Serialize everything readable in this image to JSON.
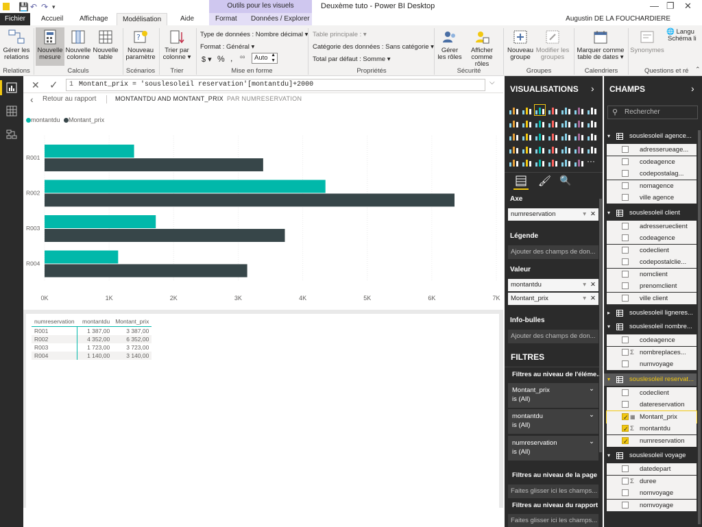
{
  "window": {
    "title": "Deuxème tuto - Power BI Desktop",
    "context_group": "Outils pour les visuels",
    "user": "Augustin DE LA FOUCHARDIERE"
  },
  "tabs": [
    "Fichier",
    "Accueil",
    "Affichage",
    "Modélisation",
    "Aide",
    "Format",
    "Données / Explorer"
  ],
  "ribbon": {
    "buttons": [
      {
        "label1": "Gérer les",
        "label2": "relations"
      },
      {
        "label1": "Nouvelle",
        "label2": "mesure"
      },
      {
        "label1": "Nouvelle",
        "label2": "colonne"
      },
      {
        "label1": "Nouvelle",
        "label2": "table"
      },
      {
        "label1": "Nouveau",
        "label2": "paramètre"
      },
      {
        "label1": "Trier par",
        "label2": "colonne ▾"
      },
      {
        "label1": "Gérer",
        "label2": "les rôles"
      },
      {
        "label1": "Afficher",
        "label2": "comme rôles"
      },
      {
        "label1": "Nouveau",
        "label2": "groupe"
      },
      {
        "label1": "Modifier les",
        "label2": "groupes"
      },
      {
        "label1": "Marquer comme",
        "label2": "table de dates ▾"
      },
      {
        "label1": "Synonymes",
        "label2": ""
      },
      {
        "label1": "Langu",
        "label2": "Schéma li"
      }
    ],
    "format": {
      "type": "Type de données : Nombre décimal ▾",
      "format": "Format : Général ▾",
      "currency": "$ ▾",
      "percent": "%",
      "comma": ",",
      "decimals": "Auto"
    },
    "properties": {
      "main_table": "Table principale : ▾",
      "category": "Catégorie des données : Sans catégorie ▾",
      "summary": "Total par défaut : Somme ▾"
    },
    "groups": [
      "Relations",
      "Calculs",
      "Scénarios",
      "Trier",
      "Mise en forme",
      "Propriétés",
      "Sécurité",
      "Groupes",
      "Calendriers",
      "Questions et ré"
    ]
  },
  "formula": {
    "line": "1",
    "text": "Montant_prix = 'souslesoleil reservation'[montantdu]+2000"
  },
  "report": {
    "back": "Retour au rapport",
    "crumb1": "MONTANTDU AND MONTANT_PRIX",
    "crumb2": "PAR NUMRESERVATION"
  },
  "chart_data": {
    "type": "bar",
    "orientation": "horizontal",
    "categories": [
      "R001",
      "R002",
      "R003",
      "R004"
    ],
    "series": [
      {
        "name": "montantdu",
        "color": "#01b8aa",
        "values": [
          1387,
          4352,
          1723,
          1140
        ]
      },
      {
        "name": "Montant_prix",
        "color": "#374649",
        "values": [
          3387,
          6352,
          3723,
          3140
        ]
      }
    ],
    "xlim": [
      0,
      7000
    ],
    "x_ticks": [
      "0K",
      "1K",
      "2K",
      "3K",
      "4K",
      "5K",
      "6K",
      "7K"
    ],
    "legend_position": "top-left",
    "grid": true
  },
  "table": {
    "headers": [
      "numreservation",
      "montantdu",
      "Montant_prix"
    ],
    "rows": [
      [
        "R001",
        "1 387,00",
        "3 387,00"
      ],
      [
        "R002",
        "4 352,00",
        "6 352,00"
      ],
      [
        "R003",
        "1 723,00",
        "3 723,00"
      ],
      [
        "R004",
        "1 140,00",
        "3 140,00"
      ]
    ]
  },
  "visualisations": {
    "title": "VISUALISATIONS",
    "axe_label": "Axe",
    "axe_value": "numreservation",
    "legende_label": "Légende",
    "legende_placeholder": "Ajouter des champs de don...",
    "valeur_label": "Valeur",
    "valeur1": "montantdu",
    "valeur2": "Montant_prix",
    "tooltips_label": "Info-bulles",
    "tooltips_placeholder": "Ajouter des champs de don...",
    "filters_title": "FILTRES",
    "filters_visual": "Filtres au niveau de l'éléme...",
    "filters": [
      {
        "name": "Montant_prix",
        "state": "is (All)"
      },
      {
        "name": "montantdu",
        "state": "is (All)"
      },
      {
        "name": "numreservation",
        "state": "is (All)"
      }
    ],
    "filters_page": "Filtres au niveau de la page",
    "filters_page_placeholder": "Faites glisser ici les champs...",
    "filters_report": "Filtres au niveau du rapport",
    "filters_report_placeholder": "Faites glisser ici les champs..."
  },
  "fields": {
    "title": "CHAMPS",
    "search_placeholder": "Rechercher",
    "tables": [
      {
        "name": "souslesoleil agence...",
        "expanded": true,
        "fields": [
          {
            "name": "adresserueage...",
            "checked": false,
            "sigma": false
          },
          {
            "name": "codeagence",
            "checked": false,
            "sigma": false
          },
          {
            "name": "codepostalag...",
            "checked": false,
            "sigma": false
          },
          {
            "name": "nomagence",
            "checked": false,
            "sigma": false
          },
          {
            "name": "ville agence",
            "checked": false,
            "sigma": false
          }
        ]
      },
      {
        "name": "souslesoleil client",
        "expanded": true,
        "fields": [
          {
            "name": "adresserueclient",
            "checked": false,
            "sigma": false
          },
          {
            "name": "codeagence",
            "checked": false,
            "sigma": false
          },
          {
            "name": "codeclient",
            "checked": false,
            "sigma": false
          },
          {
            "name": "codepostalclie...",
            "checked": false,
            "sigma": false
          },
          {
            "name": "nomclient",
            "checked": false,
            "sigma": false
          },
          {
            "name": "prenomclient",
            "checked": false,
            "sigma": false
          },
          {
            "name": "ville client",
            "checked": false,
            "sigma": false
          }
        ]
      },
      {
        "name": "souslesoleil ligneres...",
        "expanded": false,
        "fields": []
      },
      {
        "name": "souslesoleil nombre...",
        "expanded": true,
        "fields": [
          {
            "name": "codeagence",
            "checked": false,
            "sigma": false
          },
          {
            "name": "nombreplaces...",
            "checked": false,
            "sigma": true
          },
          {
            "name": "numvoyage",
            "checked": false,
            "sigma": false
          }
        ]
      },
      {
        "name": "souslesoleil reservat...",
        "expanded": true,
        "highlight": true,
        "fields": [
          {
            "name": "codeclient",
            "checked": false,
            "sigma": false
          },
          {
            "name": "datereservation",
            "checked": false,
            "sigma": false
          },
          {
            "name": "Montant_prix",
            "checked": true,
            "sigma": false,
            "calc": true
          },
          {
            "name": "montantdu",
            "checked": true,
            "sigma": true
          },
          {
            "name": "numreservation",
            "checked": true,
            "sigma": false
          }
        ]
      },
      {
        "name": "souslesoleil voyage",
        "expanded": true,
        "fields": [
          {
            "name": "datedepart",
            "checked": false,
            "sigma": false
          },
          {
            "name": "duree",
            "checked": false,
            "sigma": true
          },
          {
            "name": "nomvoyage",
            "checked": false,
            "sigma": false
          },
          {
            "name": "nomvoyage",
            "checked": false,
            "sigma": false
          }
        ]
      }
    ]
  }
}
